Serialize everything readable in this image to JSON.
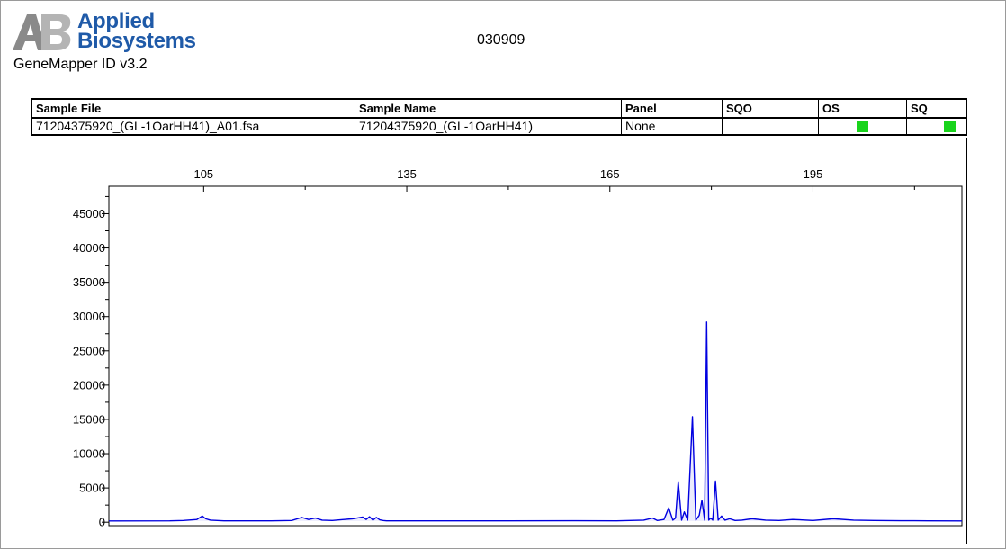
{
  "header": {
    "brand_line1": "Applied",
    "brand_line2": "Biosystems",
    "app_name": "GeneMapper ID v3.2",
    "run_id": "030909"
  },
  "table": {
    "columns": [
      "Sample File",
      "Sample Name",
      "Panel",
      "SQO",
      "OS",
      "SQ"
    ],
    "rows": [
      {
        "sample_file": "71204375920_(GL-1OarHH41)_A01.fsa",
        "sample_name": "71204375920_(GL-1OarHH41)",
        "panel": "None",
        "sqo": "",
        "os_status": "pass",
        "sq_status": "pass"
      }
    ],
    "pass_color": "#19d41c"
  },
  "chart_data": {
    "type": "line",
    "title": "",
    "xlabel": "",
    "ylabel": "",
    "xlim": [
      91,
      217
    ],
    "ylim": [
      -500,
      49000
    ],
    "x_ticks": [
      105,
      135,
      165,
      195
    ],
    "x_minor_ticks": [
      120,
      150,
      180,
      210
    ],
    "y_ticks": [
      0,
      5000,
      10000,
      15000,
      20000,
      25000,
      30000,
      35000,
      40000,
      45000
    ],
    "grid": false,
    "line_color": "#0000e0",
    "series": [
      {
        "baseline": 180,
        "x": [
          91,
          100,
          102,
          104,
          104.8,
          105.3,
          106,
          108,
          115,
          118,
          119.5,
          120.5,
          121.5,
          122.5,
          124,
          127,
          128.5,
          129,
          129.5,
          130,
          130.5,
          131,
          131.5,
          132,
          140,
          150,
          160,
          166,
          168,
          170,
          171.3,
          172,
          173,
          173.7,
          174.3,
          174.7,
          175.1,
          175.6,
          176,
          176.5,
          177.2,
          177.7,
          178.2,
          178.6,
          179,
          179.3,
          179.6,
          179.9,
          180.2,
          180.6,
          181,
          181.5,
          182,
          182.7,
          183.5,
          184.5,
          186,
          188,
          190,
          192,
          195,
          198,
          201,
          204,
          208,
          212,
          217
        ],
        "y": [
          180,
          200,
          250,
          400,
          900,
          500,
          300,
          200,
          200,
          250,
          700,
          400,
          600,
          300,
          250,
          500,
          750,
          400,
          800,
          300,
          700,
          350,
          250,
          200,
          200,
          200,
          220,
          200,
          250,
          300,
          600,
          250,
          400,
          2100,
          300,
          600,
          5900,
          300,
          1500,
          300,
          15400,
          300,
          1000,
          3200,
          300,
          29200,
          300,
          600,
          300,
          6000,
          300,
          900,
          300,
          500,
          250,
          300,
          500,
          300,
          250,
          400,
          250,
          500,
          300,
          250,
          220,
          200,
          180
        ]
      }
    ]
  }
}
